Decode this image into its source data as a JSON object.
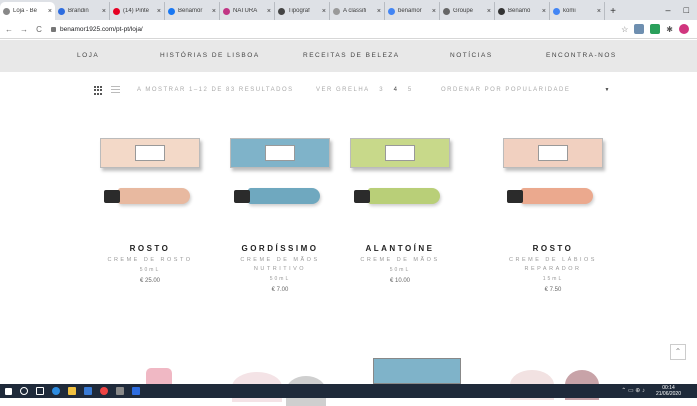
{
  "browser": {
    "tabs": [
      {
        "label": "Loja - Be",
        "color": "#888888",
        "active": true
      },
      {
        "label": "Brandin",
        "color": "#2d6cdf"
      },
      {
        "label": "(14) Pinte",
        "color": "#e60023"
      },
      {
        "label": "Benamôr",
        "color": "#1877f2"
      },
      {
        "label": "NATURA",
        "color": "#c13584"
      },
      {
        "label": "Tipograf",
        "color": "#444444"
      },
      {
        "label": "A classifi",
        "color": "#999999"
      },
      {
        "label": "benamor",
        "color": "#4285f4"
      },
      {
        "label": "Groupe",
        "color": "#666666"
      },
      {
        "label": "Benamô",
        "color": "#333333"
      },
      {
        "label": "komi",
        "color": "#4285f4"
      }
    ],
    "url": "benamor1925.com/pt-pt/loja/",
    "window_controls": [
      "–",
      "□"
    ]
  },
  "nav": {
    "items": [
      "LOJA",
      "HISTÓRIAS DE LISBOA",
      "RECEITAS DE BELEZA",
      "NOTÍCIAS",
      "ENCONTRA-NOS"
    ]
  },
  "toolbar": {
    "results": "A MOSTRAR 1–12 DE 83 RESULTADOS",
    "view_label": "VER GRELHA",
    "view_options": [
      "3",
      "4",
      "5"
    ],
    "sort_label": "ORDENAR POR POPULARIDADE"
  },
  "products": [
    {
      "name": "ROSTO",
      "desc": "CREME DE ROSTO",
      "vol": "50mL",
      "price": "€ 25.00",
      "box_color": "#f3d9c8",
      "tube_color": "#e8b9a0"
    },
    {
      "name": "GORDÍSSIMO",
      "desc": "CREME DE MÃOS NUTRITIVO",
      "vol": "50mL",
      "price": "€ 7.00",
      "box_color": "#7fb3c9",
      "tube_color": "#6fa8bf"
    },
    {
      "name": "ALANTOÍNE",
      "desc": "CREME DE MÃOS",
      "vol": "50mL",
      "price": "€ 10.00",
      "box_color": "#c8d98a",
      "tube_color": "#b9cf78"
    },
    {
      "name": "ROSTO",
      "desc": "CREME DE LÁBIOS REPARADOR",
      "vol": "15mL",
      "price": "€ 7.50",
      "box_color": "#f1d0c0",
      "tube_color": "#eba98e"
    }
  ],
  "taskbar": {
    "time": "00:14",
    "date": "21/06/2020"
  }
}
